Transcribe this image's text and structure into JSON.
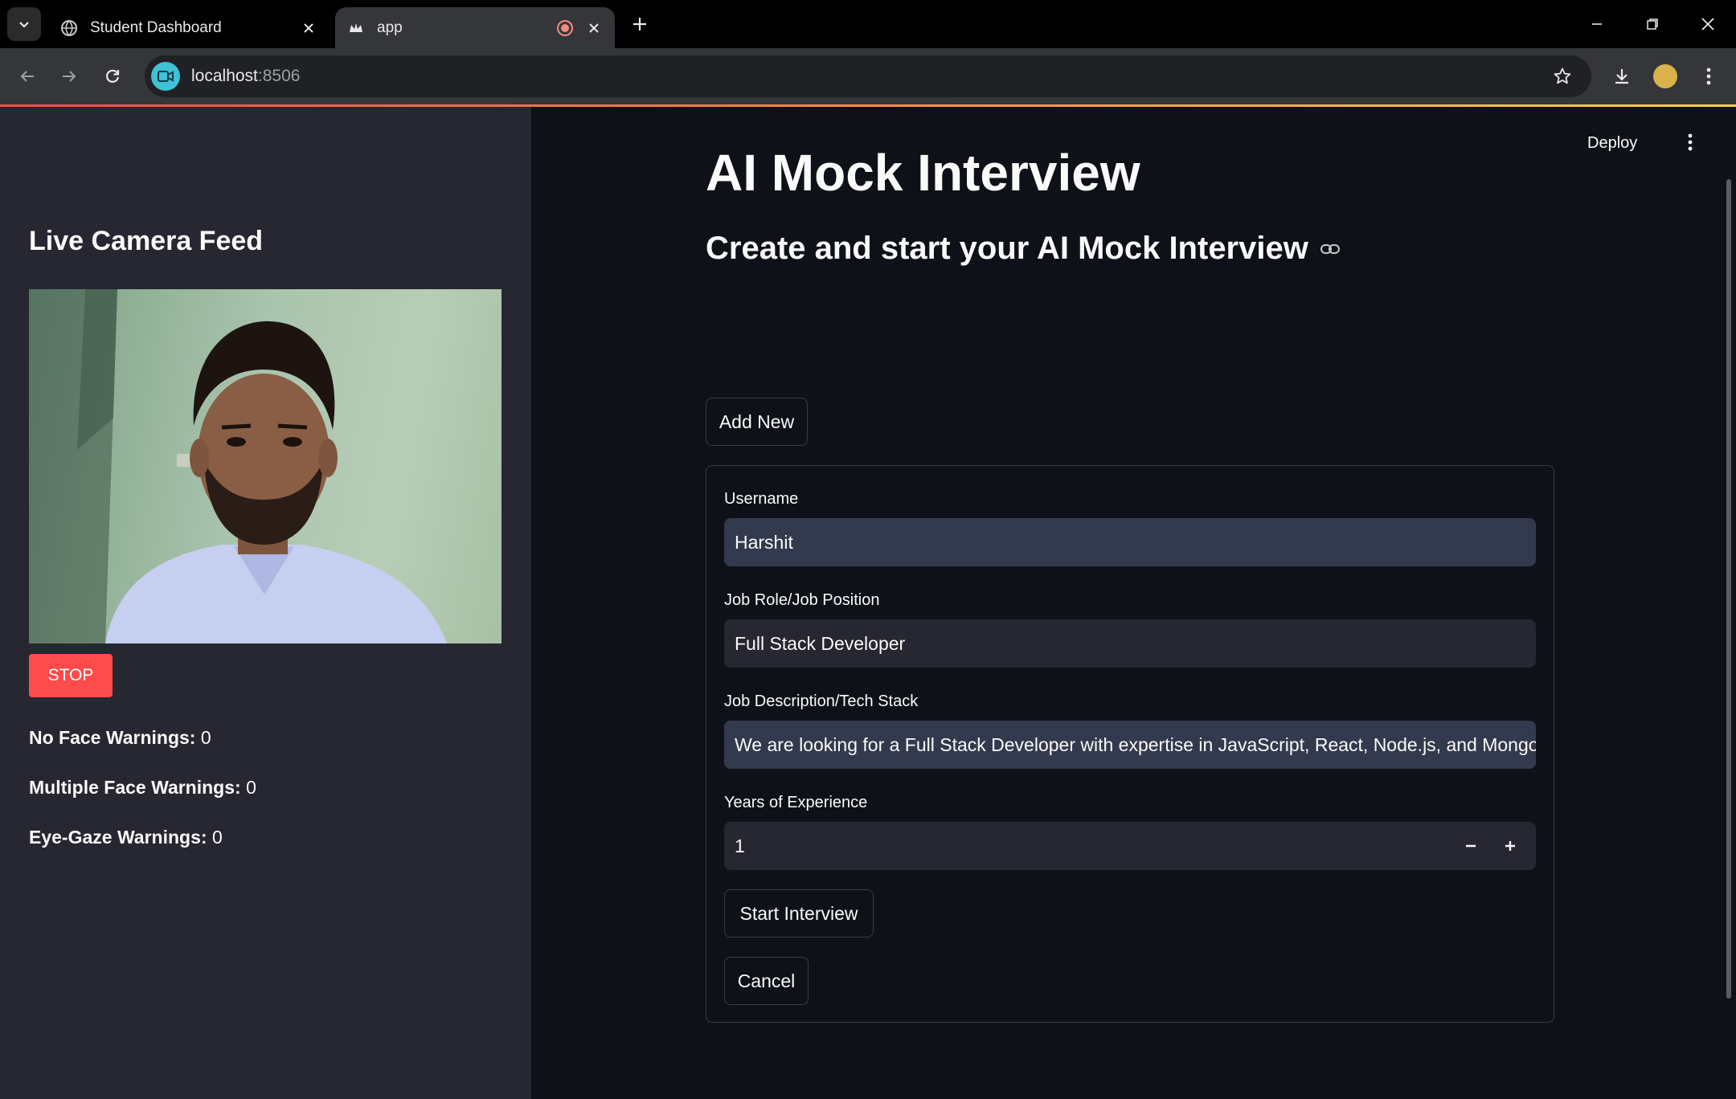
{
  "browser": {
    "tabs": [
      {
        "title": "Student Dashboard",
        "active": false,
        "icon": "globe-icon"
      },
      {
        "title": "app",
        "active": true,
        "icon": "streamlit-crown-icon"
      }
    ],
    "url_host": "localhost",
    "url_port": ":8506"
  },
  "sidebar": {
    "title": "Live Camera Feed",
    "stop_label": "STOP",
    "warnings": [
      {
        "label": "No Face Warnings:",
        "value": "0"
      },
      {
        "label": "Multiple Face Warnings:",
        "value": "0"
      },
      {
        "label": "Eye-Gaze Warnings:",
        "value": "0"
      }
    ]
  },
  "header": {
    "deploy_label": "Deploy"
  },
  "main": {
    "title": "AI Mock Interview",
    "subtitle": "Create and start your AI Mock Interview",
    "add_new_label": "Add New",
    "form": {
      "username_label": "Username",
      "username_value": "Harshit",
      "role_label": "Job Role/Job Position",
      "role_value": "Full Stack Developer",
      "desc_label": "Job Description/Tech Stack",
      "desc_value": "We are looking for a Full Stack Developer with expertise in JavaScript, React, Node.js, and MongoDB",
      "exp_label": "Years of Experience",
      "exp_value": "1",
      "start_label": "Start Interview",
      "cancel_label": "Cancel"
    }
  },
  "colors": {
    "app_bg": "#0e1117",
    "sidebar_bg": "#262730",
    "input_bg": "#262730",
    "stop_button": "#ff4b4b",
    "site_icon": "#3fc1d6"
  }
}
